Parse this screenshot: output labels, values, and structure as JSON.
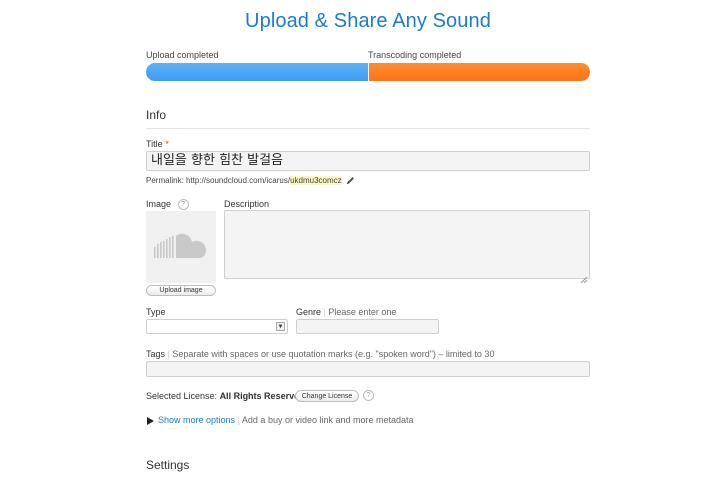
{
  "header": {
    "title": "Upload & Share Any Sound"
  },
  "progress": {
    "upload_label": "Upload completed",
    "upload_fraction": 0.5,
    "transcode_label": "Transcoding completed",
    "upload_color": "#4aa6f2",
    "transcode_color": "#fc7d22"
  },
  "info": {
    "section_title": "Info",
    "title_label": "Title",
    "required_mark": "*",
    "title_value": "내일을 향한 힘찬 발걸음",
    "permalink_prefix": "Permalink: http://soundcloud.com/icarus/",
    "permalink_slug": "ukdmu3comcz",
    "image_label": "Image",
    "help_glyph": "?",
    "upload_image_label": "Upload image",
    "description_label": "Description",
    "description_value": "",
    "type_label": "Type",
    "type_value": "",
    "select_arrow": "▼",
    "genre_label": "Genre",
    "genre_hint": "Please enter one",
    "separator": "|",
    "tags_label": "Tags",
    "tags_hint": "Separate with spaces or use quotation marks (e.g. \"spoken word\") – limited to 30",
    "license_label": "Selected License:",
    "license_value": "All Rights Reserved",
    "change_license_label": "Change License",
    "more_options_label": "Show more options",
    "more_options_hint": "Add a buy or video link and more metadata"
  },
  "settings": {
    "section_title": "Settings"
  },
  "colors": {
    "accent": "#1a7bd4",
    "required": "#e24c1d",
    "permalink_highlight": "#fbf7c3"
  }
}
